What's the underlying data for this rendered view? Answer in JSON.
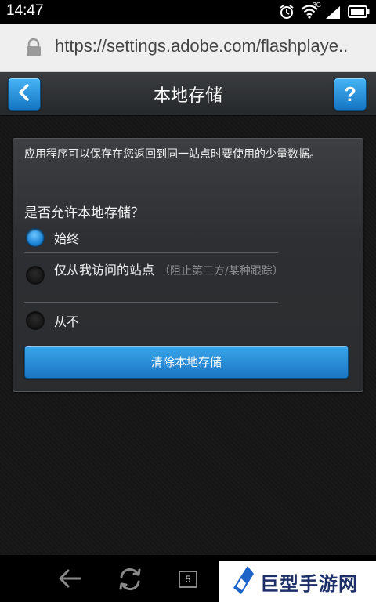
{
  "status_bar": {
    "time": "14:47",
    "network_label": "3G",
    "icons": [
      "alarm-icon",
      "wifi-icon",
      "signal-icon",
      "battery-icon"
    ]
  },
  "browser": {
    "url": "https://settings.adobe.com/flashplaye..",
    "icon": "lock-icon"
  },
  "header": {
    "title": "本地存储",
    "back_icon": "chevron-left-icon",
    "help_label": "?"
  },
  "panel": {
    "description": "应用程序可以保存在您返回到同一站点时要使用的少量数据。",
    "question": "是否允许本地存储？",
    "options": [
      {
        "label": "始终",
        "hint": "",
        "selected": true
      },
      {
        "label": "仅从我访问的站点",
        "hint": "（阻止第三方/某种跟踪）",
        "selected": false
      },
      {
        "label": "从不",
        "hint": "",
        "selected": false
      }
    ],
    "clear_button": "清除本地存储"
  },
  "nav_bar": {
    "tab_count": "5",
    "icons": [
      "back-arrow-icon",
      "refresh-icon",
      "tabs-icon"
    ]
  },
  "watermark": {
    "text": "巨型手游网"
  },
  "colors": {
    "accent": "#1b75c4",
    "radio_selected": "#2c8ee0",
    "background": "#161616"
  }
}
